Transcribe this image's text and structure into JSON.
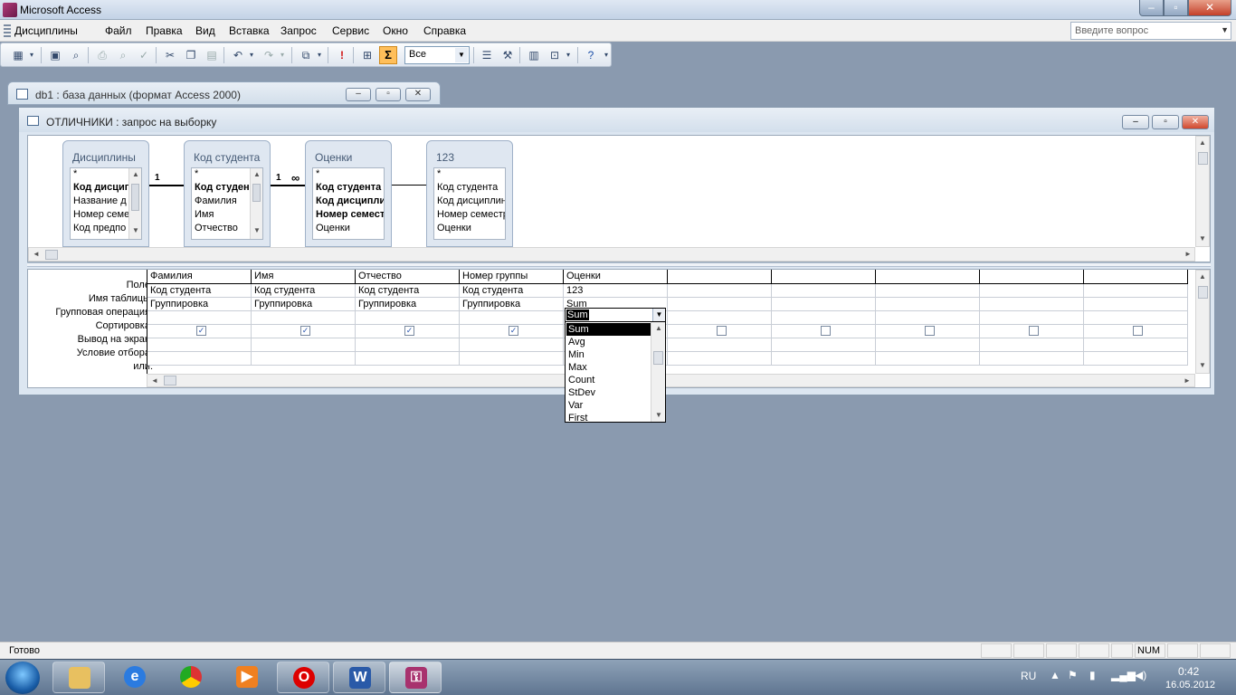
{
  "app": {
    "title": "Microsoft Access"
  },
  "menu": [
    "Дисциплины",
    "Файл",
    "Правка",
    "Вид",
    "Вставка",
    "Запрос",
    "Сервис",
    "Окно",
    "Справка"
  ],
  "help": {
    "placeholder": "Введите вопрос"
  },
  "toolbar": {
    "top_value": "Все"
  },
  "db_window": {
    "title": "db1 : база данных (формат Access 2000)"
  },
  "query_window": {
    "title": "ОТЛИЧНИКИ : запрос на выборку"
  },
  "tables": [
    {
      "name": "Дисциплины",
      "fields": [
        "*",
        "Код дисциплины",
        "Название д",
        "Номер семе",
        "Код предпо"
      ],
      "bold": [
        1
      ]
    },
    {
      "name": "Код студента",
      "fields": [
        "*",
        "Код студента",
        "Фамилия",
        "Имя",
        "Отчество"
      ],
      "bold": [
        1
      ]
    },
    {
      "name": "Оценки",
      "fields": [
        "*",
        "Код студента",
        "Код дисципли",
        "Номер семестр",
        "Оценки"
      ],
      "bold": [
        1,
        2,
        3
      ]
    },
    {
      "name": "123",
      "fields": [
        "*",
        "Код студента",
        "Код дисциплин",
        "Номер семестр",
        "Оценки"
      ],
      "bold": []
    }
  ],
  "relations": [
    {
      "left": "1",
      "right": "1"
    },
    {
      "left": "1",
      "right": "∞"
    }
  ],
  "grid": {
    "row_labels": [
      "Поле:",
      "Имя таблицы:",
      "Групповая операция:",
      "Сортировка:",
      "Вывод на экран:",
      "Условие отбора:",
      "или:"
    ],
    "columns": [
      {
        "field": "Фамилия",
        "table": "Код студента",
        "group": "Группировка",
        "show": true
      },
      {
        "field": "Имя",
        "table": "Код студента",
        "group": "Группировка",
        "show": true
      },
      {
        "field": "Отчество",
        "table": "Код студента",
        "group": "Группировка",
        "show": true
      },
      {
        "field": "Номер группы",
        "table": "Код студента",
        "group": "Группировка",
        "show": true
      },
      {
        "field": "Оценки",
        "table": "123",
        "group": "Sum",
        "show": false
      },
      {
        "field": "",
        "table": "",
        "group": "",
        "show": false
      },
      {
        "field": "",
        "table": "",
        "group": "",
        "show": false
      },
      {
        "field": "",
        "table": "",
        "group": "",
        "show": false
      },
      {
        "field": "",
        "table": "",
        "group": "",
        "show": false
      },
      {
        "field": "",
        "table": "",
        "group": "",
        "show": false
      }
    ]
  },
  "dropdown": {
    "value": "Sum",
    "options": [
      "Sum",
      "Avg",
      "Min",
      "Max",
      "Count",
      "StDev",
      "Var",
      "First"
    ],
    "selected": 0
  },
  "status": {
    "text": "Готово",
    "num": "NUM"
  },
  "tray": {
    "lang": "RU",
    "time": "0:42",
    "date": "16.05.2012"
  }
}
